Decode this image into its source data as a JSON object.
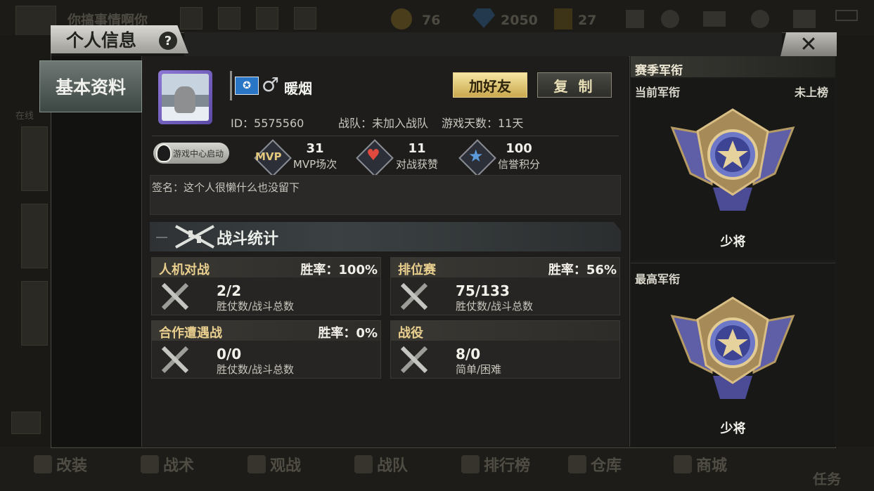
{
  "background": {
    "top_title": "你搞事情啊你",
    "gold": "76",
    "diamonds": "2050",
    "tickets": "27",
    "left_labels": [
      "在线"
    ],
    "bottom_menu": [
      "改装",
      "战术",
      "观战",
      "战队",
      "排行榜",
      "仓库",
      "商城"
    ],
    "bottom_right": "任务"
  },
  "header": {
    "title": "个人信息",
    "help": "?",
    "close": "✕"
  },
  "sidebar": {
    "tab_basic": "基本资料"
  },
  "profile": {
    "gender_symbol": "♂",
    "name": "暖烟",
    "add_friend": "加好友",
    "copy": "复 制",
    "id": "ID：5575560",
    "team": "战队：未加入战队",
    "days": "游戏天数：11天",
    "qq_launch": "游戏中心启动"
  },
  "stats": [
    {
      "icon": "MVP",
      "value": "31",
      "label": "MVP场次"
    },
    {
      "icon": "heart",
      "value": "11",
      "label": "对战获赞"
    },
    {
      "icon": "star",
      "value": "100",
      "label": "信誉积分"
    }
  ],
  "signature": "签名：这个人很懒什么也没留下",
  "battle": {
    "title": "战斗统计",
    "cards": [
      {
        "title": "人机对战",
        "rate": "胜率：100%",
        "value": "2/2",
        "sub": "胜仗数/战斗总数"
      },
      {
        "title": "排位赛",
        "rate": "胜率：56%",
        "value": "75/133",
        "sub": "胜仗数/战斗总数"
      },
      {
        "title": "合作遭遇战",
        "rate": "胜率：0%",
        "value": "0/0",
        "sub": "胜仗数/战斗总数"
      },
      {
        "title": "战役",
        "rate": "",
        "value": "8/0",
        "sub": "简单/困难"
      }
    ]
  },
  "season": {
    "title": "赛季军衔",
    "current_label": "当前军衔",
    "current_status": "未上榜",
    "current_rank": "少将",
    "highest_label": "最高军衔",
    "highest_rank": "少将"
  },
  "colors": {
    "gold_button": "#c9a84e",
    "accent_gold_text": "#e9cf8e",
    "avatar_frame": "#8c78d4"
  }
}
